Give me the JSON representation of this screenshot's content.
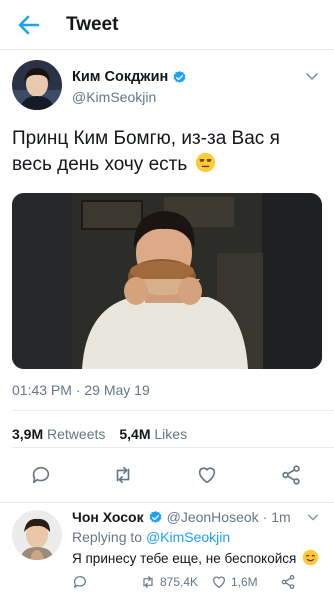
{
  "header": {
    "title": "Tweet",
    "back_icon": "arrow-left-icon"
  },
  "tweet": {
    "author_name": "Ким Сокджин",
    "author_handle": "@KimSeokjin",
    "text": "Принц Ким Бомгю, из-за Вас я весь день хочу есть",
    "emoji": "unamused-face-emoji",
    "timestamp": "01:43 PM · 29 May 19",
    "retweets_count": "3,9M",
    "retweets_label": "Retweets",
    "likes_count": "5,4M",
    "likes_label": "Likes"
  },
  "reply": {
    "author_name": "Чон Хосок",
    "author_handle": "@JeonHoseok",
    "time": "· 1m",
    "replying_prefix": "Replying to",
    "replying_handle": "@KimSeokjin",
    "text": "Я принесу тебе еще, не беспокойся",
    "emoji": "smiling-face-emoji",
    "retweets": "875,4K",
    "likes": "1,6M"
  },
  "colors": {
    "accent": "#1da1f2",
    "text": "#14171a",
    "secondary": "#657786",
    "divider": "#e6ecf0"
  }
}
